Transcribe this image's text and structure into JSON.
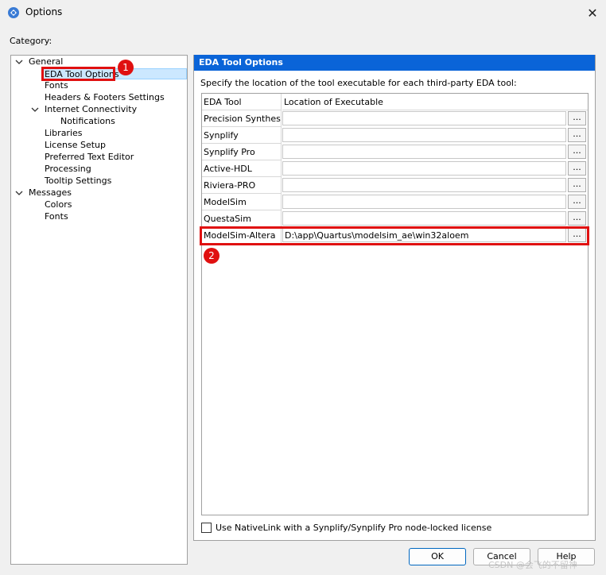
{
  "window": {
    "title": "Options",
    "close_symbol": "✕"
  },
  "category_label": "Category:",
  "tree": {
    "items": [
      {
        "label": "General",
        "level": 0,
        "expanded": true
      },
      {
        "label": "EDA Tool Options",
        "level": 1,
        "selected": true
      },
      {
        "label": "Fonts",
        "level": 1
      },
      {
        "label": "Headers & Footers Settings",
        "level": 1
      },
      {
        "label": "Internet Connectivity",
        "level": 1,
        "expanded": true
      },
      {
        "label": "Notifications",
        "level": 2
      },
      {
        "label": "Libraries",
        "level": 1
      },
      {
        "label": "License Setup",
        "level": 1
      },
      {
        "label": "Preferred Text Editor",
        "level": 1
      },
      {
        "label": "Processing",
        "level": 1
      },
      {
        "label": "Tooltip Settings",
        "level": 1
      },
      {
        "label": "Messages",
        "level": 0,
        "expanded": true
      },
      {
        "label": "Colors",
        "level": 1
      },
      {
        "label": "Fonts",
        "level": 1
      }
    ]
  },
  "panel": {
    "header": "EDA Tool Options",
    "description": "Specify the location of the tool executable for each third-party EDA tool:",
    "columns": {
      "tool": "EDA Tool",
      "location": "Location of Executable"
    },
    "browse_label": "...",
    "rows": [
      {
        "tool": "Precision Synthesis",
        "path": ""
      },
      {
        "tool": "Synplify",
        "path": ""
      },
      {
        "tool": "Synplify Pro",
        "path": ""
      },
      {
        "tool": "Active-HDL",
        "path": ""
      },
      {
        "tool": "Riviera-PRO",
        "path": ""
      },
      {
        "tool": "ModelSim",
        "path": ""
      },
      {
        "tool": "QuestaSim",
        "path": ""
      },
      {
        "tool": "ModelSim-Altera",
        "path": "D:\\app\\Quartus\\modelsim_ae\\win32aloem"
      }
    ],
    "nativelink_label": "Use NativeLink with a Synplify/Synplify Pro node-locked license",
    "nativelink_checked": false
  },
  "buttons": {
    "ok": "OK",
    "cancel": "Cancel",
    "help": "Help"
  },
  "annotations": {
    "marker1": "1",
    "marker2": "2",
    "color": "#e01010"
  },
  "watermark": "CSDN @会飞的不留神",
  "colors": {
    "header_bg": "#0a64d8",
    "selection_bg": "#cce8ff"
  }
}
